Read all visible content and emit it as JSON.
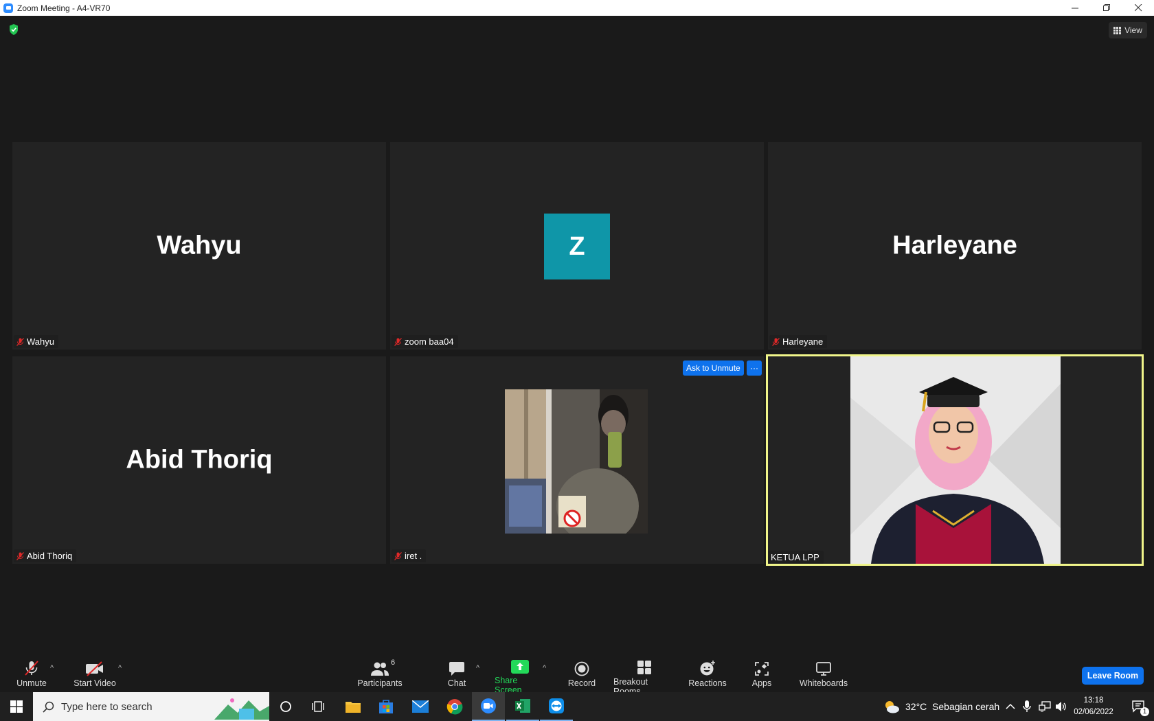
{
  "window": {
    "title": "Zoom Meeting - A4-VR70"
  },
  "top": {
    "view_label": "View"
  },
  "tiles": [
    {
      "display": "Wahyu",
      "name": "Wahyu"
    },
    {
      "display": "Z",
      "name": "zoom baa04"
    },
    {
      "display": "Harleyane",
      "name": "Harleyane"
    },
    {
      "display": "Abid Thoriq",
      "name": "Abid Thoriq"
    },
    {
      "display": "",
      "name": "iret ."
    },
    {
      "display": "",
      "name": "KETUA LPP"
    }
  ],
  "ask_to_unmute": "Ask to Unmute",
  "more_label": "···",
  "toolbar": {
    "unmute": "Unmute",
    "start_video": "Start Video",
    "participants": "Participants",
    "participants_count": "6",
    "chat": "Chat",
    "share_screen": "Share Screen",
    "record": "Record",
    "breakout_rooms": "Breakout Rooms",
    "reactions": "Reactions",
    "apps": "Apps",
    "whiteboards": "Whiteboards",
    "leave_room": "Leave Room"
  },
  "taskbar": {
    "search_placeholder": "Type here to search",
    "weather": "32°C  Sebagian cerah",
    "time": "13:18",
    "date": "02/06/2022",
    "notifications": "1"
  },
  "colors": {
    "accent": "#0e72ed",
    "active_speaker": "#f0f58a",
    "share_green": "#23d959",
    "avatar_teal": "#0f96a8"
  }
}
